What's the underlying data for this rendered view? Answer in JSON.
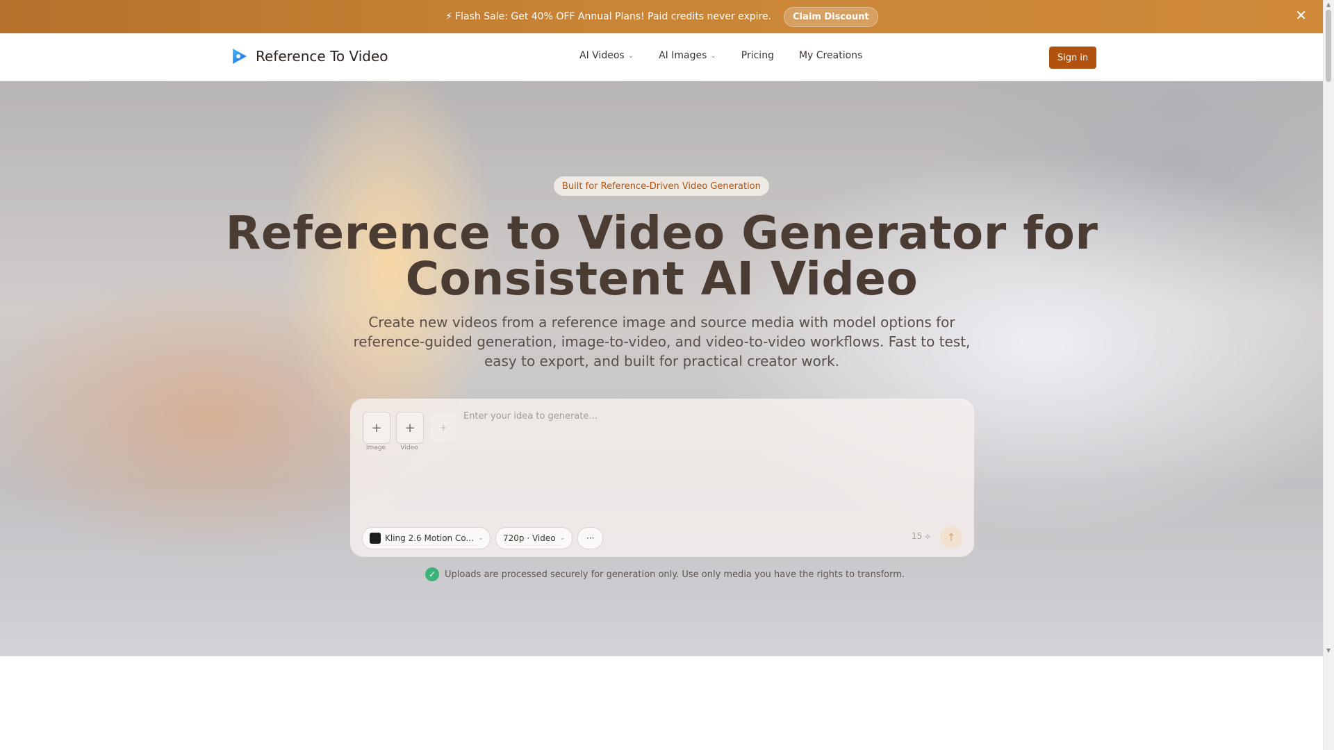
{
  "promo": {
    "bolt": "⚡",
    "text": "Flash Sale: Get 40% OFF Annual Plans! Paid credits never expire.",
    "claim_label": "Claim Discount",
    "close": "✕"
  },
  "header": {
    "brand": "Reference To Video",
    "nav": [
      {
        "label": "AI Videos",
        "chevron": "⌄"
      },
      {
        "label": "AI Images",
        "chevron": "⌄"
      },
      {
        "label": "Pricing"
      },
      {
        "label": "My Creations"
      }
    ],
    "signin": "Sign in"
  },
  "hero": {
    "tag": "Built for Reference-Driven Video Generation",
    "headline_line1": "Reference to Video Generator for",
    "headline_line2": "Consistent AI Video",
    "subtitle": "Create new videos from a reference image and source media with model options for reference-guided generation, image-to-video, and video-to-video workflows. Fast to test, easy to export, and built for practical creator work."
  },
  "composer": {
    "uploads": [
      {
        "icon": "+",
        "label": "Image"
      },
      {
        "icon": "+",
        "label": "Video"
      },
      {
        "icon": "+",
        "label": ""
      }
    ],
    "placeholder": "Enter your idea to generate...",
    "model": "Kling 2.6 Motion Co...",
    "quality": "720p · Video",
    "more": "···",
    "credits": "15 ⟡",
    "send": "↑"
  },
  "notice": "Uploads are processed securely for generation only. Use only media you have the rights to transform.",
  "colors": {
    "accent": "#b0520e",
    "banner": "#c98436",
    "success": "#3db27a"
  }
}
